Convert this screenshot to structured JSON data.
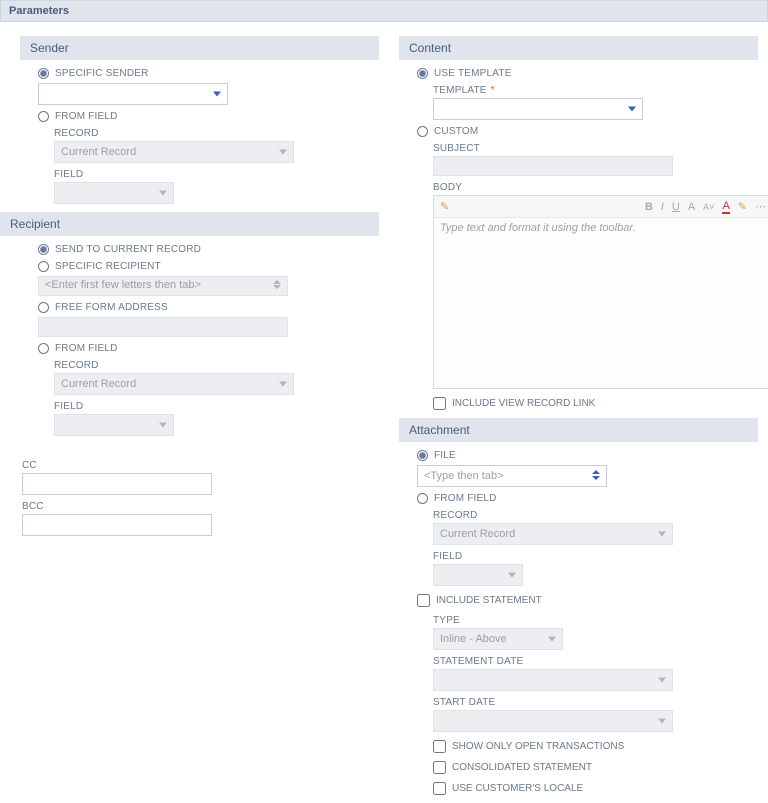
{
  "headers": {
    "main": "Parameters",
    "sender": "Sender",
    "recipient": "Recipient",
    "content": "Content",
    "attachment": "Attachment"
  },
  "sender": {
    "specific_label": "SPECIFIC SENDER",
    "from_field_label": "FROM FIELD",
    "record_label": "RECORD",
    "record_value": "Current Record",
    "field_label": "FIELD"
  },
  "recipient": {
    "send_current_label": "SEND TO CURRENT RECORD",
    "specific_label": "SPECIFIC RECIPIENT",
    "specific_placeholder": "<Enter first few letters then tab>",
    "freeform_label": "FREE FORM ADDRESS",
    "from_field_label": "FROM FIELD",
    "record_label": "RECORD",
    "record_value": "Current Record",
    "field_label": "FIELD",
    "cc_label": "CC",
    "bcc_label": "BCC"
  },
  "content": {
    "use_template_label": "USE TEMPLATE",
    "template_label": "TEMPLATE",
    "custom_label": "CUSTOM",
    "subject_label": "SUBJECT",
    "body_label": "BODY",
    "body_placeholder": "Type text and format it using the toolbar.",
    "include_view_label": "INCLUDE VIEW RECORD LINK"
  },
  "attachment": {
    "file_label": "FILE",
    "file_placeholder": "<Type then tab>",
    "from_field_label": "FROM FIELD",
    "record_label": "RECORD",
    "record_value": "Current Record",
    "field_label": "FIELD",
    "include_statement_label": "INCLUDE STATEMENT",
    "type_label": "TYPE",
    "type_value": "Inline - Above",
    "statement_date_label": "STATEMENT DATE",
    "start_date_label": "START DATE",
    "show_open_label": "SHOW ONLY OPEN TRANSACTIONS",
    "consolidated_label": "CONSOLIDATED STATEMENT",
    "use_locale_label": "USE CUSTOMER'S LOCALE"
  },
  "rte_toolbar": {
    "edit": "✎",
    "bold": "B",
    "italic": "I",
    "underline": "U",
    "font": "A",
    "fontsize": "A˅",
    "color": "A",
    "highlight": "✎",
    "more": "⋯"
  }
}
